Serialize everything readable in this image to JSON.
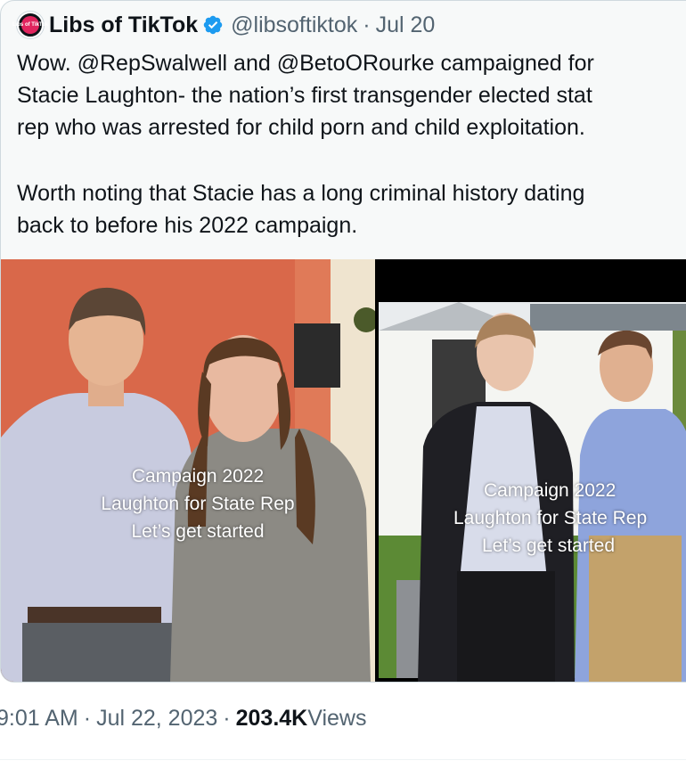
{
  "quoted_tweet": {
    "avatar_text": "Libs of TikTok",
    "author_name": "Libs of TikTok",
    "handle": "@libsoftiktok",
    "separator": "·",
    "date": "Jul 20",
    "text_lines": [
      "Wow. @RepSwalwell and @BetoORourke campaigned for",
      "Stacie Laughton- the nation’s first transgender elected stat",
      "rep who was arrested for child porn and child exploitation.",
      "",
      "Worth noting that Stacie has a long criminal history dating",
      "back to before his 2022 campaign."
    ],
    "media": {
      "left_overlay": [
        "Campaign 2022",
        "Laughton for State Rep",
        "Let’s get started"
      ],
      "right_overlay": [
        "Campaign 2022",
        "Laughton for State Rep",
        "Let’s get started"
      ]
    }
  },
  "footer": {
    "time": "9:01 AM",
    "separator": "·",
    "date": "Jul 22, 2023",
    "views_count": "203.4K",
    "views_label": "Views"
  },
  "colors": {
    "verified": "#1d9bf0",
    "secondary_text": "#536471",
    "card_border": "#cfd9de"
  }
}
